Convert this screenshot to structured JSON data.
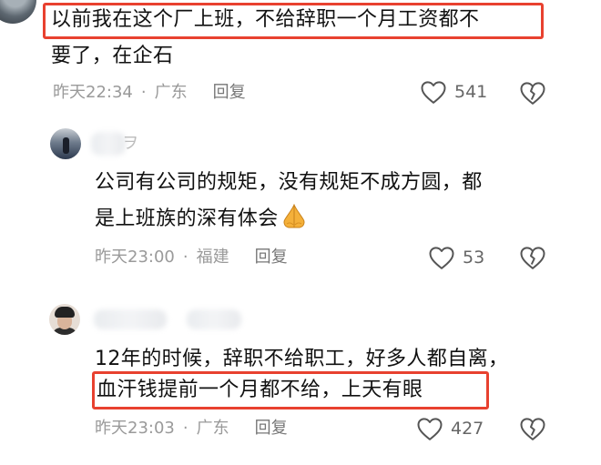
{
  "comments": [
    {
      "lines": [
        "以前我在这个厂上班，不给辞职一个月工资都不",
        "要了，在企石"
      ],
      "time": "昨天22:34",
      "sep": "·",
      "location": "广东",
      "reply_label": "回复",
      "likes": "541"
    },
    {
      "username_suffix": "ヲ",
      "lines": [
        "公司有公司的规矩，没有规矩不成方圆，都",
        "是上班族的深有体会"
      ],
      "time": "昨天23:00",
      "sep": "·",
      "location": "福建",
      "reply_label": "回复",
      "likes": "53"
    },
    {
      "lines": [
        "12年的时候，辞职不给职工，好多人都自离，",
        "血汗钱提前一个月都不给，上天有眼"
      ],
      "time": "昨天23:03",
      "sep": "·",
      "location": "广东",
      "reply_label": "回复",
      "likes": "427"
    }
  ],
  "colors": {
    "highlight_box": "#e8412f",
    "meta_text": "#9a9a9a",
    "emoji": "#f0a92c"
  },
  "icons": {
    "like": "heart-outline-icon",
    "dislike": "broken-heart-icon",
    "emoji": "pressed-hands-emoji"
  }
}
